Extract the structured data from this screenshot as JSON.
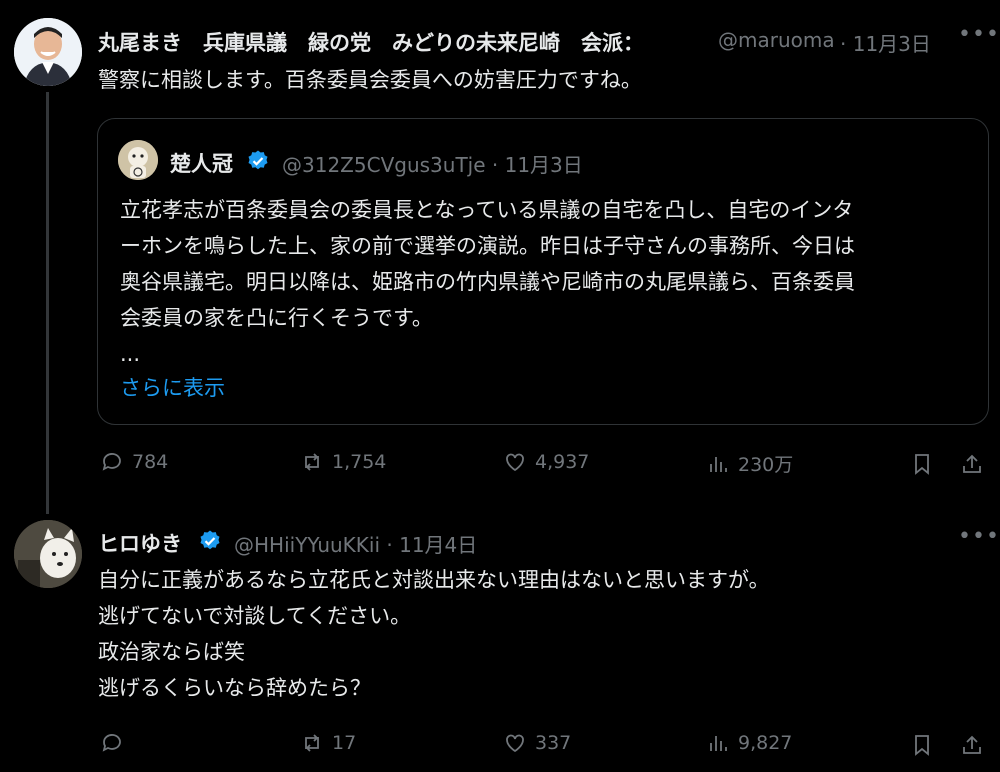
{
  "tweet1": {
    "name": "丸尾まき　兵庫県議　緑の党　みどりの未来尼崎　会派：",
    "handle": "@maruoma",
    "date": "· 11月3日",
    "text": "警察に相談します。百条委員会委員への妨害圧力ですね。",
    "quote": {
      "name": "楚人冠",
      "handle": "@312Z5CVgus3uTje · 11月3日",
      "lines": [
        "立花孝志が百条委員会の委員長となっている県議の自宅を凸し、自宅のインタ",
        "ーホンを鳴らした上、家の前で選挙の演説。昨日は子守さんの事務所、今日は",
        "奥谷県議宅。明日以降は、姫路市の竹内県議や尼崎市の丸尾県議ら、百条委員",
        "会委員の家を凸に行くそうです。"
      ],
      "ellipsis": "...",
      "show_more": "さらに表示"
    },
    "stats": {
      "replies": "784",
      "reposts": "1,754",
      "likes": "4,937",
      "views": "230万"
    }
  },
  "tweet2": {
    "name": "ヒロゆき",
    "handle": "@HHiiYYuuKKii · 11月4日",
    "lines": [
      "自分に正義があるなら立花氏と対談出来ない理由はないと思いますが。",
      "逃げてないで対談してください。",
      "政治家ならば笑",
      "逃げるくらいなら辞めたら？"
    ],
    "stats": {
      "replies": "",
      "reposts": "17",
      "likes": "337",
      "views": "9,827"
    }
  },
  "colors": {
    "background": "#000000",
    "text": "#e7e9ea",
    "muted": "#71767b",
    "link": "#1d9bf0",
    "verified": "#1d9bf0"
  }
}
